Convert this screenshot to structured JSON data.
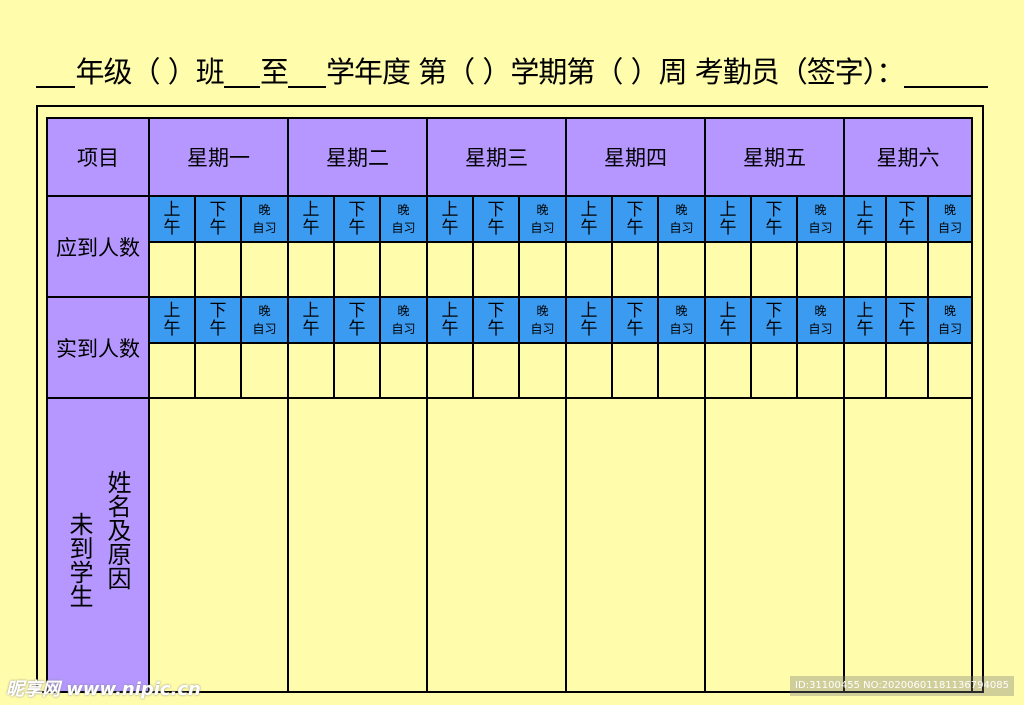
{
  "header": {
    "part1": "年级（ ）班",
    "part2": "至",
    "part3": "学年度 第（ ）学期第（ ）周 考勤员（签字）："
  },
  "table": {
    "corner_label": "项目",
    "days": [
      "星期一",
      "星期二",
      "星期三",
      "星期四",
      "星期五",
      "星期六"
    ],
    "periods": [
      {
        "top": "上",
        "bottom": "午"
      },
      {
        "top": "下",
        "bottom": "午"
      },
      {
        "top": "晚",
        "bottom": "自习"
      }
    ],
    "rows": {
      "expected": "应到人数",
      "actual": "实到人数",
      "absent_col1": "未到学生",
      "absent_col2": "姓名及原因"
    }
  },
  "watermark": {
    "left": "昵享网 www.nipic.cn",
    "right": "ID:31100455 NO:20200601181136794085"
  },
  "colors": {
    "background": "#fffcab",
    "header_purple": "#b597ff",
    "period_blue": "#3b9bf0"
  }
}
